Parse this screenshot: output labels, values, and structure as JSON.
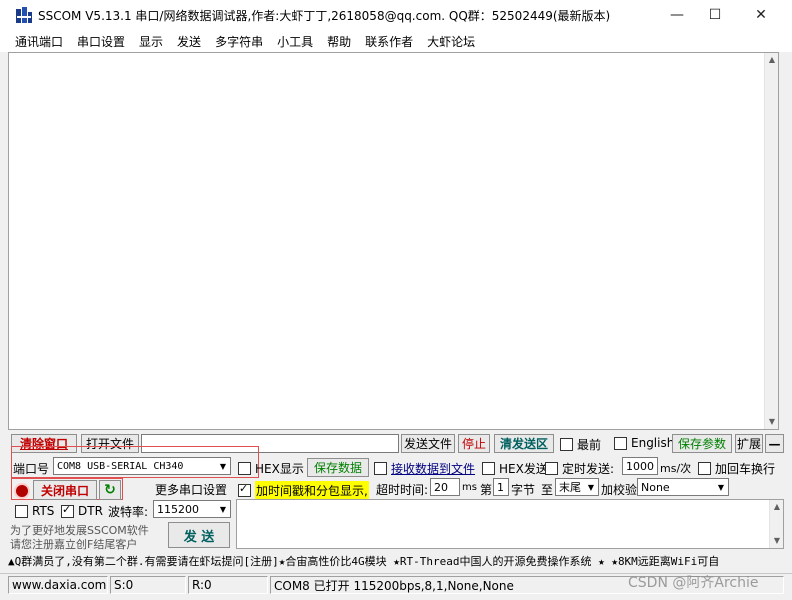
{
  "window": {
    "title": "SSCOM V5.13.1 串口/网络数据调试器,作者:大虾丁丁,2618058@qq.com. QQ群：52502449(最新版本)",
    "minimize": "—",
    "maximize": "☐",
    "close": "✕"
  },
  "menu": [
    "通讯端口",
    "串口设置",
    "显示",
    "发送",
    "多字符串",
    "小工具",
    "帮助",
    "联系作者",
    "大虾论坛"
  ],
  "toolbar": {
    "clear_window": "清除窗口",
    "open_file": "打开文件",
    "send_file": "发送文件",
    "stop": "停止",
    "clear_send": "清发送区",
    "topmost": "最前",
    "english": "English",
    "save_params": "保存参数",
    "expand": "扩展",
    "collapse": "—"
  },
  "port": {
    "label": "端口号",
    "value": "COM8 USB-SERIAL CH340",
    "close_button": "关闭串口",
    "more_settings": "更多串口设置",
    "rts": "RTS",
    "dtr": "DTR",
    "baud_label": "波特率:",
    "baud_value": "115200"
  },
  "options": {
    "hex_display": "HEX显示",
    "save_data": "保存数据",
    "recv_to_file": "接收数据到文件",
    "hex_send": "HEX发送",
    "timed_send": "定时发送:",
    "timed_value": "1000",
    "timed_unit": "ms/次",
    "add_crlf": "加回车换行",
    "timestamp": "加时间戳和分包显示,",
    "timeout_label": "超时时间:",
    "timeout_value": "20",
    "timeout_unit": "ms",
    "nth_label": "第",
    "nth_value": "1",
    "byte_label": "字节",
    "to_label": "至",
    "end_value": "末尾",
    "checksum_label": "加校验",
    "checksum_value": "None"
  },
  "promo": {
    "line1": "为了更好地发展SSCOM软件",
    "line2": "请您注册嘉立创F结尾客户",
    "send_button": "发 送"
  },
  "ticker": "▲Q群满员了,没有第二个群.有需要请在虾坛提问[注册]★合宙高性价比4G模块 ★RT-Thread中国人的开源免费操作系统 ★ ★8KM远距离WiFi可自",
  "status": {
    "site": "www.daxia.com",
    "s": "S:0",
    "r": "R:0",
    "info": "COM8 已打开  115200bps,8,1,None,None"
  },
  "watermark": "CSDN @阿齐Archie",
  "colors": {
    "accent_green": "#008000",
    "highlight_yellow": "#ffff00",
    "red_text": "#c00000",
    "red_outline": "#e05050"
  }
}
